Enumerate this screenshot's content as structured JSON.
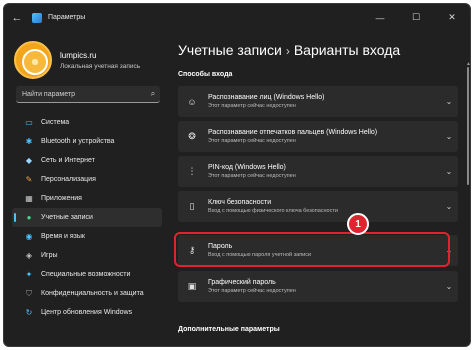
{
  "window": {
    "title": "Параметры"
  },
  "controls": {
    "back": "←",
    "minimize": "—",
    "maximize": "☐",
    "close": "✕"
  },
  "profile": {
    "name": "lumpics.ru",
    "subtitle": "Локальная учетная запись"
  },
  "search": {
    "placeholder": "Найти параметр"
  },
  "nav": {
    "items": [
      {
        "label": "Система",
        "icon": "monitor-icon",
        "color": "#4cc2ff"
      },
      {
        "label": "Bluetooth и устройства",
        "icon": "bluetooth-icon",
        "color": "#4cc2ff"
      },
      {
        "label": "Сеть и Интернет",
        "icon": "wifi-icon",
        "color": "#9ad6ff"
      },
      {
        "label": "Персонализация",
        "icon": "brush-icon",
        "color": "#f0a24a"
      },
      {
        "label": "Приложения",
        "icon": "apps-icon",
        "color": "#c8c8c8"
      },
      {
        "label": "Учетные записи",
        "icon": "person-icon",
        "color": "#4cd08a"
      },
      {
        "label": "Время и язык",
        "icon": "globe-icon",
        "color": "#4cc2ff"
      },
      {
        "label": "Игры",
        "icon": "gamepad-icon",
        "color": "#c8c8c8"
      },
      {
        "label": "Специальные возможности",
        "icon": "accessibility-icon",
        "color": "#4cc2ff"
      },
      {
        "label": "Конфиденциальность и защита",
        "icon": "shield-icon",
        "color": "#9a9a9a"
      },
      {
        "label": "Центр обновления Windows",
        "icon": "update-icon",
        "color": "#4cc2ff"
      }
    ],
    "active_index": 5
  },
  "breadcrumb": {
    "parent": "Учетные записи",
    "separator": "›",
    "current": "Варианты входа"
  },
  "sections": {
    "sign_in_methods": "Способы входа",
    "additional": "Дополнительные параметры"
  },
  "options": [
    {
      "title": "Распознавание лиц (Windows Hello)",
      "subtitle": "Этот параметр сейчас недоступен",
      "icon": "face-icon"
    },
    {
      "title": "Распознавание отпечатков пальцев (Windows Hello)",
      "subtitle": "Этот параметр сейчас недоступен",
      "icon": "fingerprint-icon"
    },
    {
      "title": "PIN-код (Windows Hello)",
      "subtitle": "Этот параметр сейчас недоступен",
      "icon": "keypad-icon"
    },
    {
      "title": "Ключ безопасности",
      "subtitle": "Вход с помощью физического ключа безопасности",
      "icon": "usb-key-icon"
    },
    {
      "title": "Пароль",
      "subtitle": "Вход с помощью пароля учетной записи",
      "icon": "key-icon"
    },
    {
      "title": "Графический пароль",
      "subtitle": "Этот параметр сейчас недоступен",
      "icon": "picture-icon"
    }
  ],
  "annotation": {
    "step": "1",
    "color": "#e0242f"
  }
}
